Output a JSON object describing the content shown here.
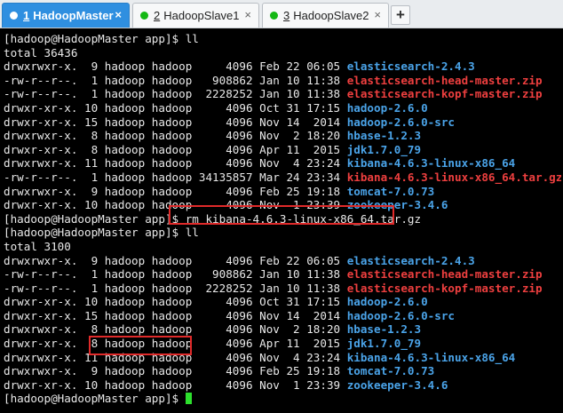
{
  "tabs": [
    {
      "number": "1",
      "label": "HadoopMaster",
      "active": true,
      "close": "×"
    },
    {
      "number": "2",
      "label": "HadoopSlave1",
      "active": false,
      "close": "×"
    },
    {
      "number": "3",
      "label": "HadoopSlave2",
      "active": false,
      "close": "×"
    }
  ],
  "add_tab": "+",
  "colors": {
    "dir": "#4aa3e8",
    "archive": "#ee3f3f",
    "link": "#2fc4d9",
    "cursor": "#2de02d",
    "highlight": "#e02a2a"
  },
  "lines": [
    [
      {
        "t": "[hadoop@HadoopMaster app]$ ll"
      }
    ],
    [
      {
        "t": "total 36436"
      }
    ],
    [
      {
        "t": "drwxrwxr-x.  9 hadoop hadoop     4096 Feb 22 06:05 "
      },
      {
        "t": "elasticsearch-2.4.3",
        "c": "blue"
      }
    ],
    [
      {
        "t": "-rw-r--r--.  1 hadoop hadoop   908862 Jan 10 11:38 "
      },
      {
        "t": "elasticsearch-head-master.zip",
        "c": "red"
      }
    ],
    [
      {
        "t": "-rw-r--r--.  1 hadoop hadoop  2228252 Jan 10 11:38 "
      },
      {
        "t": "elasticsearch-kopf-master.zip",
        "c": "red"
      }
    ],
    [
      {
        "t": "drwxr-xr-x. 10 hadoop hadoop     4096 Oct 31 17:15 "
      },
      {
        "t": "hadoop-2.6.0",
        "c": "blue"
      }
    ],
    [
      {
        "t": "drwxr-xr-x. 15 hadoop hadoop     4096 Nov 14  2014 "
      },
      {
        "t": "hadoop-2.6.0-src",
        "c": "blue"
      }
    ],
    [
      {
        "t": "drwxrwxr-x.  8 hadoop hadoop     4096 Nov  2 18:20 "
      },
      {
        "t": "hbase-1.2.3",
        "c": "blue"
      }
    ],
    [
      {
        "t": "drwxr-xr-x.  8 hadoop hadoop     4096 Apr 11  2015 "
      },
      {
        "t": "jdk1.7.0_79",
        "c": "blue"
      }
    ],
    [
      {
        "t": "drwxrwxr-x. 11 hadoop hadoop     4096 Nov  4 23:24 "
      },
      {
        "t": "kibana-4.6.3-linux-x86_64",
        "c": "blue"
      }
    ],
    [
      {
        "t": "-rw-r--r--.  1 hadoop hadoop 34135857 Mar 24 23:34 "
      },
      {
        "t": "kibana-4.6.3-linux-x86_64.tar.gz",
        "c": "red"
      }
    ],
    [
      {
        "t": "drwxrwxr-x.  9 hadoop hadoop     4096 Feb 25 19:18 "
      },
      {
        "t": "tomcat-7.0.73",
        "c": "blue"
      }
    ],
    [
      {
        "t": "drwxr-xr-x. 10 hadoop hadoop     4096 Nov  1 23:39 "
      },
      {
        "t": "zookeeper-3.4.6",
        "c": "blue"
      }
    ],
    [
      {
        "t": "[hadoop@HadoopMaster app]$ rm kibana-4.6.3-linux-x86_64.tar.gz"
      }
    ],
    [
      {
        "t": "[hadoop@HadoopMaster app]$ ll"
      }
    ],
    [
      {
        "t": "total 3100"
      }
    ],
    [
      {
        "t": "drwxrwxr-x.  9 hadoop hadoop     4096 Feb 22 06:05 "
      },
      {
        "t": "elasticsearch-2.4.3",
        "c": "blue"
      }
    ],
    [
      {
        "t": "-rw-r--r--.  1 hadoop hadoop   908862 Jan 10 11:38 "
      },
      {
        "t": "elasticsearch-head-master.zip",
        "c": "red"
      }
    ],
    [
      {
        "t": "-rw-r--r--.  1 hadoop hadoop  2228252 Jan 10 11:38 "
      },
      {
        "t": "elasticsearch-kopf-master.zip",
        "c": "red"
      }
    ],
    [
      {
        "t": "drwxr-xr-x. 10 hadoop hadoop     4096 Oct 31 17:15 "
      },
      {
        "t": "hadoop-2.6.0",
        "c": "blue"
      }
    ],
    [
      {
        "t": "drwxr-xr-x. 15 hadoop hadoop     4096 Nov 14  2014 "
      },
      {
        "t": "hadoop-2.6.0-src",
        "c": "blue"
      }
    ],
    [
      {
        "t": "drwxrwxr-x.  8 hadoop hadoop     4096 Nov  2 18:20 "
      },
      {
        "t": "hbase-1.2.3",
        "c": "blue"
      }
    ],
    [
      {
        "t": "drwxr-xr-x.  8 hadoop hadoop     4096 Apr 11  2015 "
      },
      {
        "t": "jdk1.7.0_79",
        "c": "blue"
      }
    ],
    [
      {
        "t": "drwxrwxr-x. 11 hadoop hadoop     4096 Nov  4 23:24 "
      },
      {
        "t": "kibana-4.6.3-linux-x86_64",
        "c": "blue"
      }
    ],
    [
      {
        "t": "drwxrwxr-x.  9 hadoop hadoop     4096 Feb 25 19:18 "
      },
      {
        "t": "tomcat-7.0.73",
        "c": "blue"
      }
    ],
    [
      {
        "t": "drwxr-xr-x. 10 hadoop hadoop     4096 Nov  1 23:39 "
      },
      {
        "t": "zookeeper-3.4.6",
        "c": "blue"
      }
    ],
    [
      {
        "t": "[hadoop@HadoopMaster app]$ "
      }
    ]
  ]
}
